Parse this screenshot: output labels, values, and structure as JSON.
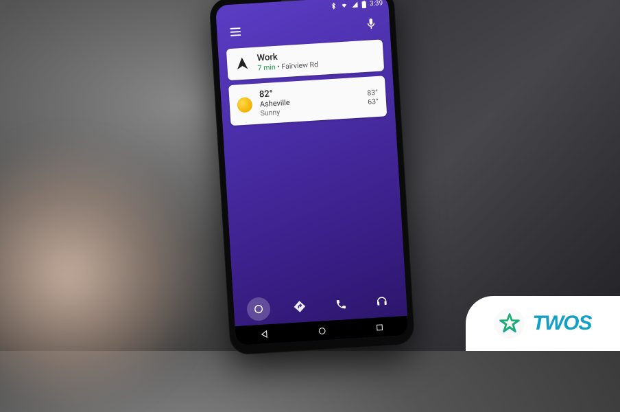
{
  "status_bar": {
    "time": "3:39",
    "icons": [
      "bluetooth",
      "wifi",
      "signal",
      "battery"
    ]
  },
  "header": {
    "menu_label": "Menu",
    "mic_label": "Voice search"
  },
  "cards": {
    "navigation": {
      "title": "Work",
      "eta": "7 min",
      "separator": " • ",
      "route": "Fairview Rd"
    },
    "weather": {
      "temp": "82°",
      "location": "Asheville",
      "condition": "Sunny",
      "high": "83°",
      "low": "63°"
    }
  },
  "bottom_nav": {
    "items": [
      "home",
      "navigation",
      "phone",
      "music"
    ]
  },
  "softkeys": {
    "items": [
      "back",
      "home",
      "recents"
    ]
  },
  "badge": {
    "text": "TWOS"
  }
}
